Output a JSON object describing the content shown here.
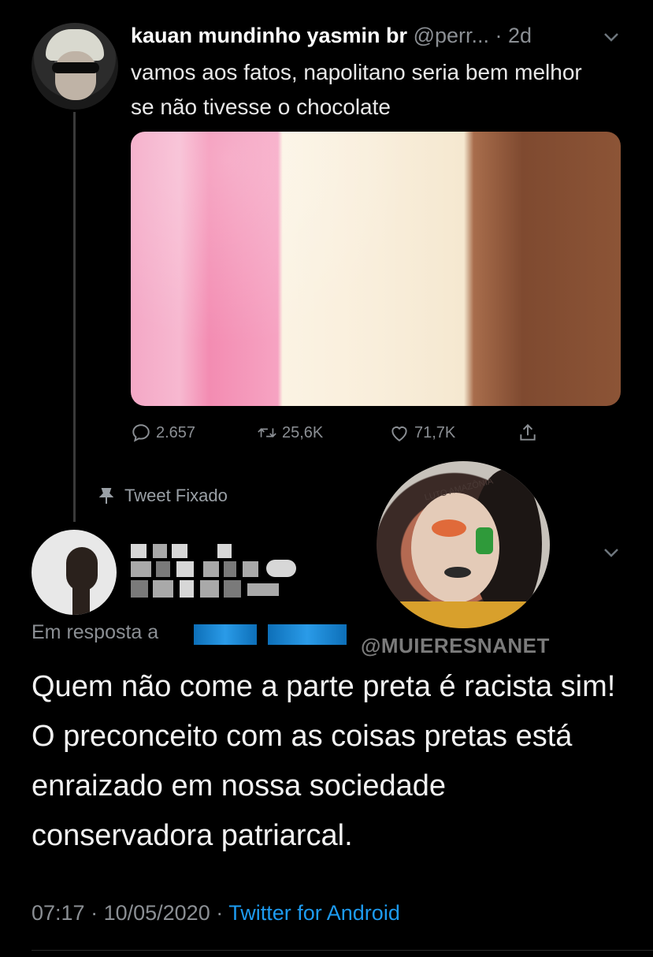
{
  "tweet1": {
    "display_name": "kauan mundinho yasmin br",
    "handle": "@perr...",
    "time_sep": " · ",
    "time": "2d",
    "text": "vamos aos fatos, napolitano seria bem melhor se não tivesse o chocolate",
    "image_alt_icon": "neapolitan-ice-cream-photo",
    "replies": "2.657",
    "retweets": "25,6K",
    "likes": "71,7K"
  },
  "pinned_label": "Tweet Fixado",
  "tweet2": {
    "reply_to_prefix": "Em resposta a",
    "text": "Quem não come a parte preta é racista sim! O preconceito com as coisas pretas está enraizado em nossa sociedade conservadora patriarcal.",
    "time": "07:17",
    "sep": " · ",
    "date": "10/05/2020",
    "source": "Twitter for Android"
  },
  "overlay": {
    "face_text": "LUTO AMAZÔNIA"
  },
  "watermark": "@MUIERESNANET",
  "colors": {
    "background": "#000000",
    "muted": "#8b8f94",
    "link": "#1d9bf0"
  }
}
